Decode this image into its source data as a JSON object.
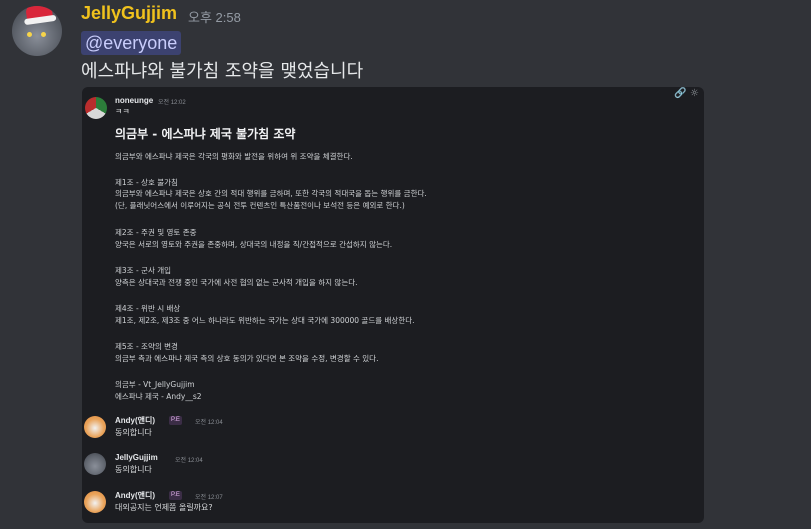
{
  "message": {
    "username": "JellyGujjim",
    "timestamp": "오후 2:58",
    "mention": "@everyone",
    "text": "에스파냐와 불가침 조약을 맺었습니다",
    "colors": {
      "username": "#f0c21d",
      "mention_bg": "#3c4270",
      "background": "#313338"
    }
  },
  "attachment": {
    "toolbar_icons": [
      "link-icon",
      "reply-icon"
    ],
    "post": {
      "author": "noneunge",
      "time": "오전 12:02",
      "reaction_text": "ㅋㅋ",
      "treaty_title": "의금부 - 에스파냐 제국 불가침 조약",
      "lines": [
        "의금부와 에스파냐 제국은 각국의 평화와 발전을 위하여 위 조약을 체결한다.",
        "제1조 - 상호 불가침",
        "의금부와 에스파냐 제국은 상호 간의 적대 행위를 금하며, 또한 각국의 적대국을 돕는 행위를 금한다.",
        "(단, 플래닛어스에서 이루어지는 공식 전투 컨텐츠인 특산품전이나 보석전 등은 예외로 한다.)",
        "제2조 - 주권 및 영토 존중",
        "양국은 서로의 영토와 주권을 존중하며, 상대국의 내정을 직/간접적으로 간섭하지 않는다.",
        "제3조 - 군사 개입",
        "양측은 상대국과 전쟁 중인 국가에 사전 협의 없는 군사적 개입을 하지 않는다.",
        "제4조 - 위반 시 배상",
        "제1조, 제2조, 제3조 중 어느 하나라도 위반하는 국가는 상대 국가에 300000 골드를 배상한다.",
        "제5조 - 조약의 변경",
        "의금부 측과 에스파냐 제국 측의 상호 동의가 있다면 본 조약을 수정, 변경할 수 있다.",
        "의금부 - Vt_JellyGujjim",
        "에스파냐 제국 - Andy__s2"
      ]
    },
    "replies": [
      {
        "author": "Andy(앤디)",
        "badge": "P.E",
        "time": "오전 12:04",
        "text": "동의합니다"
      },
      {
        "author": "JellyGujjim",
        "badge": "",
        "time": "오전 12:04",
        "text": "동의합니다"
      },
      {
        "author": "Andy(앤디)",
        "badge": "P.E",
        "time": "오전 12:07",
        "text": "대외공지는 언제쯤 올릴까요?"
      }
    ]
  }
}
